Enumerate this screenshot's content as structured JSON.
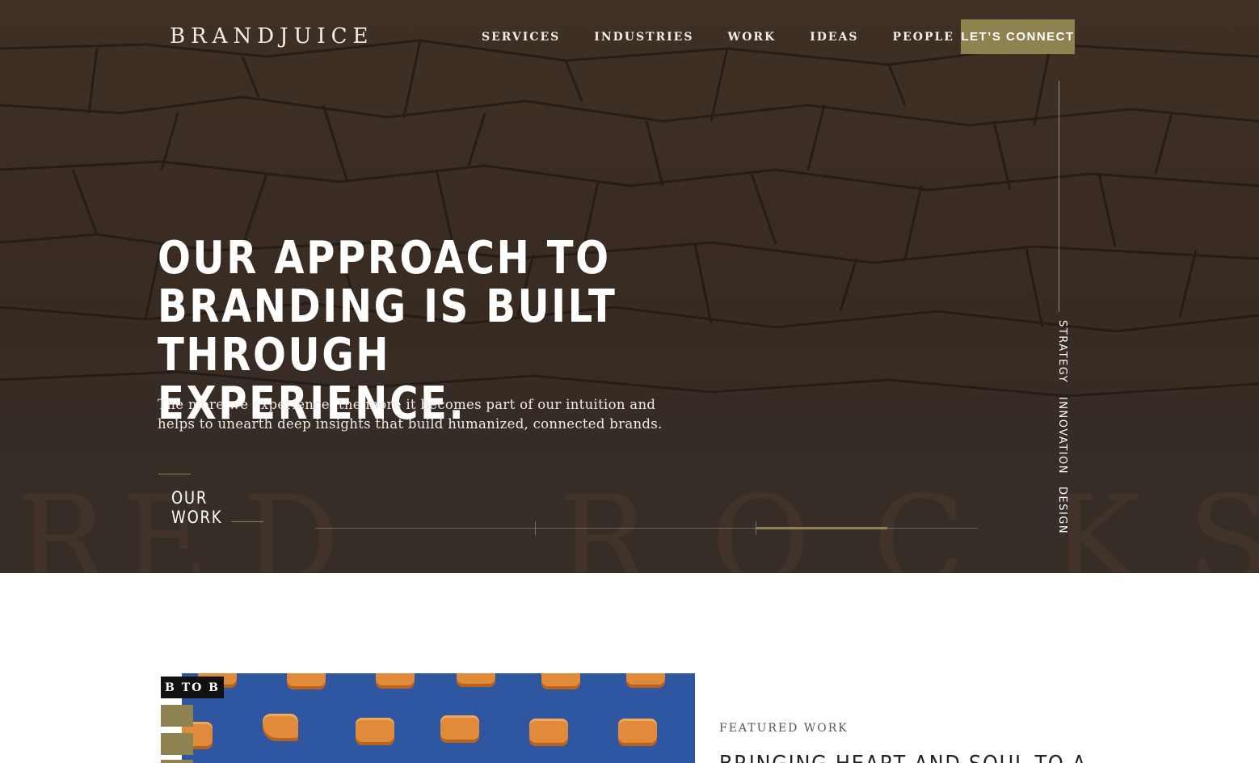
{
  "header": {
    "logo": "BRANDJUICE",
    "nav": [
      "SERVICES",
      "INDUSTRIES",
      "WORK",
      "IDEAS",
      "PEOPLE"
    ],
    "cta": "LET’S CONNECT"
  },
  "hero": {
    "title_lines": [
      "OUR APPROACH TO",
      "BRANDING IS BUILT",
      "THROUGH EXPERIENCE."
    ],
    "subtitle_lines": [
      "The more we experience, the more it becomes part of our intuition and",
      "helps to unearth deep insights that build humanized, connected brands."
    ],
    "cta": "OUR WORK",
    "side_nav": [
      "STRATEGY",
      "INNOVATION",
      "DESIGN"
    ],
    "slider_progress": 0.5
  },
  "featured": {
    "tag": "B TO B",
    "label": "FEATURED WORK",
    "title": "BRINGING HEART AND SOUL TO A"
  },
  "colors": {
    "accent": "#8f8251",
    "hero_bg": "#3e3028",
    "image_blue": "#2f56a0"
  }
}
